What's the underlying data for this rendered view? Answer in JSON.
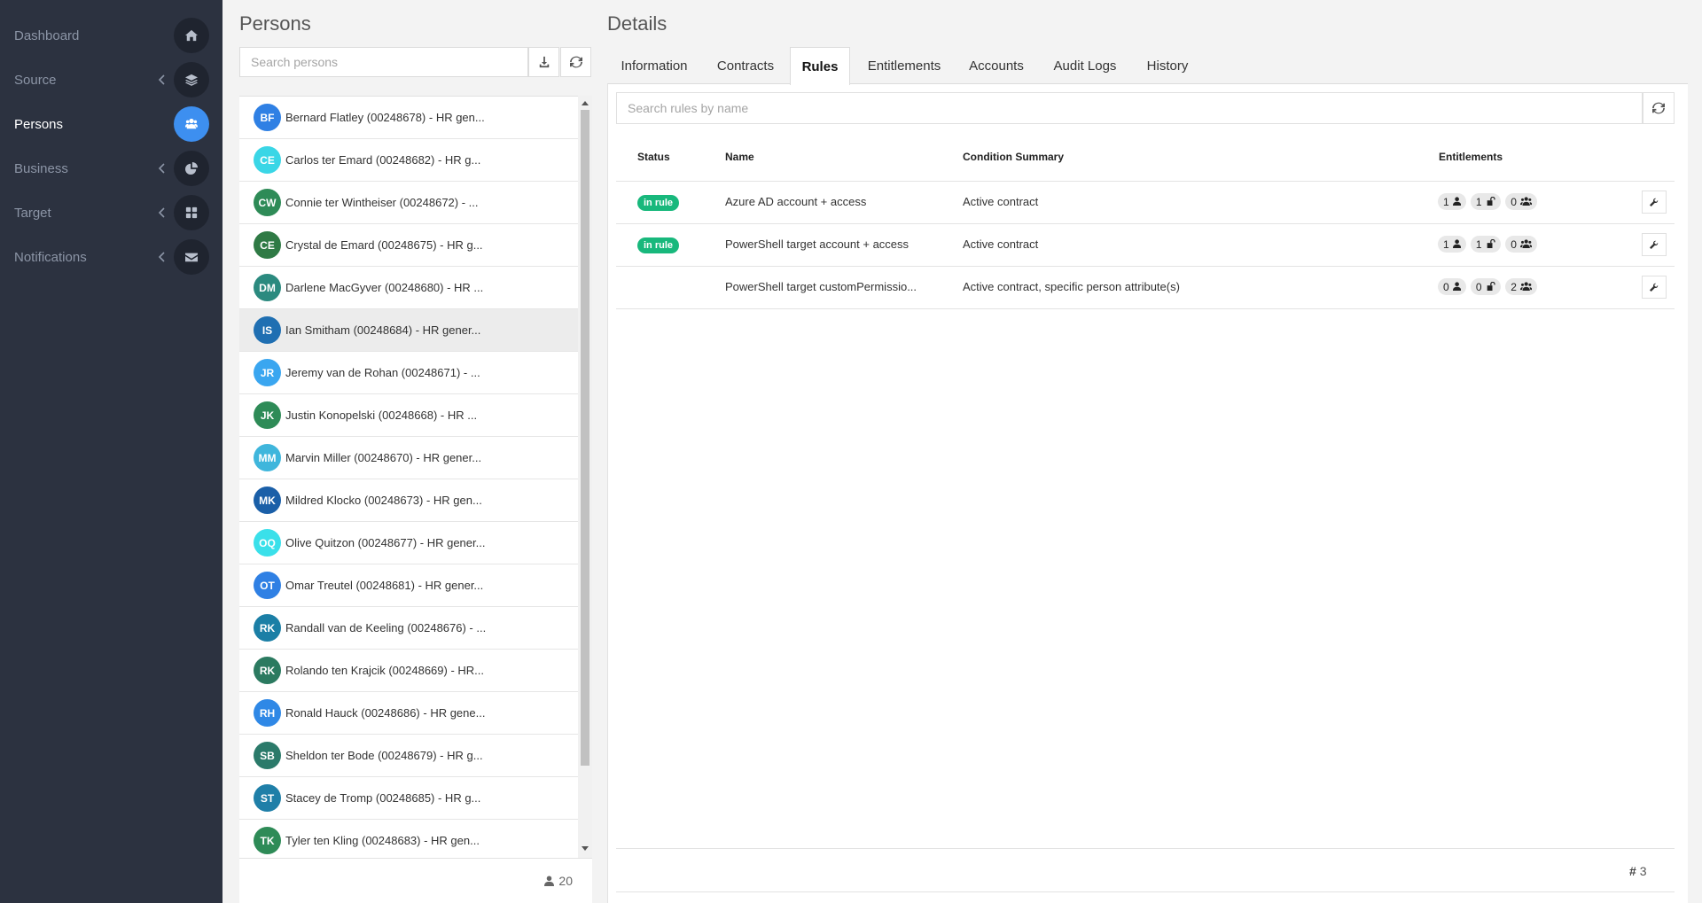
{
  "sidebar": {
    "items": [
      {
        "label": "Dashboard",
        "icon": "home-icon",
        "active": false,
        "chevron": false
      },
      {
        "label": "Source",
        "icon": "layers-icon",
        "active": false,
        "chevron": true
      },
      {
        "label": "Persons",
        "icon": "users-icon",
        "active": true,
        "chevron": false
      },
      {
        "label": "Business",
        "icon": "pie-chart-icon",
        "active": false,
        "chevron": true
      },
      {
        "label": "Target",
        "icon": "grid-icon",
        "active": false,
        "chevron": true
      },
      {
        "label": "Notifications",
        "icon": "envelope-icon",
        "active": false,
        "chevron": true
      }
    ]
  },
  "persons": {
    "title": "Persons",
    "search_placeholder": "Search persons",
    "count": "20",
    "list": [
      {
        "initials": "BF",
        "color": "#2f80e4",
        "name": "Bernard Flatley (00248678) - HR gen..."
      },
      {
        "initials": "CE",
        "color": "#3ad6e6",
        "name": "Carlos ter Emard (00248682) - HR g..."
      },
      {
        "initials": "CW",
        "color": "#2e8b57",
        "name": "Connie ter Wintheiser (00248672) - ..."
      },
      {
        "initials": "CE",
        "color": "#2f7a45",
        "name": "Crystal de Emard (00248675) - HR g..."
      },
      {
        "initials": "DM",
        "color": "#2b8a7f",
        "name": "Darlene MacGyver (00248680) - HR ..."
      },
      {
        "initials": "IS",
        "color": "#1f6fb2",
        "name": "Ian Smitham (00248684) - HR gener...",
        "selected": true
      },
      {
        "initials": "JR",
        "color": "#3aa6f0",
        "name": "Jeremy van de Rohan (00248671) - ..."
      },
      {
        "initials": "JK",
        "color": "#2e8b57",
        "name": "Justin Konopelski (00248668) - HR ..."
      },
      {
        "initials": "MM",
        "color": "#3fb6dc",
        "name": "Marvin Miller (00248670) - HR gener..."
      },
      {
        "initials": "MK",
        "color": "#1a5fa8",
        "name": "Mildred Klocko (00248673) - HR gen..."
      },
      {
        "initials": "OQ",
        "color": "#3ae0ea",
        "name": "Olive Quitzon (00248677) - HR gener..."
      },
      {
        "initials": "OT",
        "color": "#2f80e4",
        "name": "Omar Treutel (00248681) - HR gener..."
      },
      {
        "initials": "RK",
        "color": "#1b7fa6",
        "name": "Randall van de Keeling (00248676) - ..."
      },
      {
        "initials": "RK",
        "color": "#2b7a60",
        "name": "Rolando ten Krajcik (00248669) - HR..."
      },
      {
        "initials": "RH",
        "color": "#2f88e6",
        "name": "Ronald Hauck (00248686) - HR gene..."
      },
      {
        "initials": "SB",
        "color": "#2b7a6a",
        "name": "Sheldon ter Bode (00248679) - HR g..."
      },
      {
        "initials": "ST",
        "color": "#1f7fa8",
        "name": "Stacey de Tromp (00248685) - HR g..."
      },
      {
        "initials": "TK",
        "color": "#2e8b57",
        "name": "Tyler ten Kling (00248683) - HR gen..."
      }
    ]
  },
  "details": {
    "title": "Details",
    "tabs": [
      {
        "label": "Information",
        "active": false
      },
      {
        "label": "Contracts",
        "active": false
      },
      {
        "label": "Rules",
        "active": true
      },
      {
        "label": "Entitlements",
        "active": false
      },
      {
        "label": "Accounts",
        "active": false
      },
      {
        "label": "Audit Logs",
        "active": false
      },
      {
        "label": "History",
        "active": false
      }
    ],
    "rules_search_placeholder": "Search rules by name",
    "columns": {
      "status": "Status",
      "name": "Name",
      "condition": "Condition Summary",
      "entitlements": "Entitlements"
    },
    "rules": [
      {
        "status": "in rule",
        "name": "Azure AD account + access",
        "condition": "Active contract",
        "accounts": "1",
        "permissions": "1",
        "groups": "0"
      },
      {
        "status": "in rule",
        "name": "PowerShell target account + access",
        "condition": "Active contract",
        "accounts": "1",
        "permissions": "1",
        "groups": "0"
      },
      {
        "status": "",
        "name": "PowerShell target customPermissio...",
        "condition": "Active contract, specific person attribute(s)",
        "accounts": "0",
        "permissions": "0",
        "groups": "2"
      }
    ],
    "rules_count": "3"
  }
}
